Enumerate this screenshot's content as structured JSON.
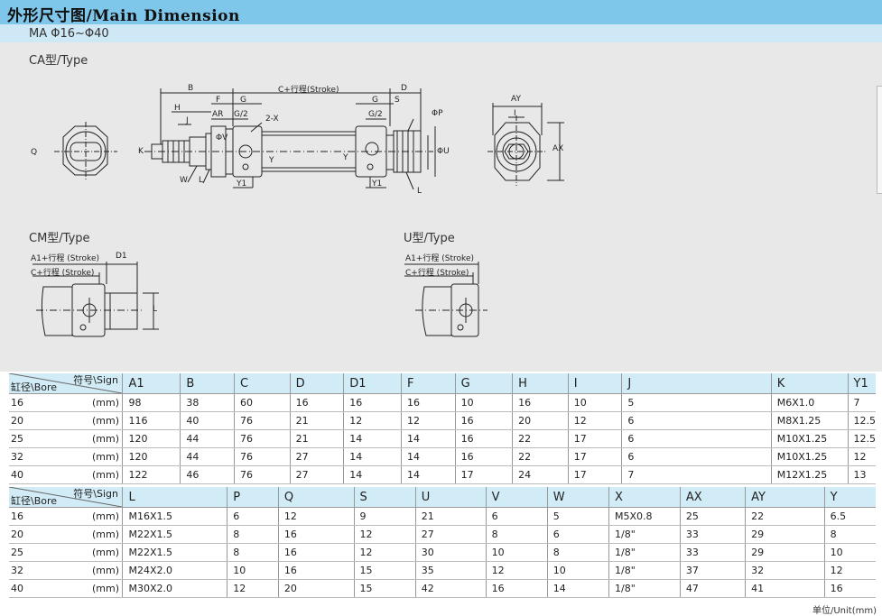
{
  "header": {
    "title": "外形尺寸图/Main Dimension",
    "model": "MA Φ16~Φ40"
  },
  "drawings": {
    "ca_label": "CA型/Type",
    "cm_label": "CM型/Type",
    "u_label": "U型/Type",
    "ca_dims": {
      "b": "B",
      "h": "H",
      "j": "J",
      "k": "K",
      "w": "W",
      "l": "L",
      "f": "F",
      "ar": "AR",
      "g": "G",
      "g2": "G/2",
      "twox": "2-X",
      "y1": "Y1",
      "y": "Y",
      "v": "ΦV",
      "stroke": "C+行程(Stroke)",
      "d": "D",
      "s": "S",
      "p": "ΦP",
      "u": "ΦU",
      "ay": "AY",
      "i": "I",
      "ax": "AX",
      "q": "Q"
    },
    "cm_dims": {
      "a1": "A1+行程 (Stroke)",
      "d1": "D1",
      "c": "C+行程 (Stroke)",
      "l": "L"
    },
    "u_dims": {
      "a1": "A1+行程 (Stroke)",
      "c": "C+行程 (Stroke)"
    }
  },
  "table1": {
    "corner_sign": "符号\\Sign",
    "corner_bore": "缸径\\Bore",
    "columns": [
      "A1",
      "B",
      "C",
      "D",
      "D1",
      "F",
      "G",
      "H",
      "I",
      "J",
      "K",
      "Y1"
    ],
    "rows": [
      {
        "bore": "16",
        "unit": "(mm)",
        "cells": [
          "98",
          "38",
          "60",
          "16",
          "16",
          "16",
          "10",
          "16",
          "10",
          "5",
          "M6X1.0",
          "7"
        ]
      },
      {
        "bore": "20",
        "unit": "(mm)",
        "cells": [
          "116",
          "40",
          "76",
          "21",
          "12",
          "12",
          "16",
          "20",
          "12",
          "6",
          "M8X1.25",
          "12.5"
        ]
      },
      {
        "bore": "25",
        "unit": "(mm)",
        "cells": [
          "120",
          "44",
          "76",
          "21",
          "14",
          "14",
          "16",
          "22",
          "17",
          "6",
          "M10X1.25",
          "12.5"
        ]
      },
      {
        "bore": "32",
        "unit": "(mm)",
        "cells": [
          "120",
          "44",
          "76",
          "27",
          "14",
          "14",
          "16",
          "22",
          "17",
          "6",
          "M10X1.25",
          "12"
        ]
      },
      {
        "bore": "40",
        "unit": "(mm)",
        "cells": [
          "122",
          "46",
          "76",
          "27",
          "14",
          "14",
          "17",
          "24",
          "17",
          "7",
          "M12X1.25",
          "13"
        ]
      }
    ]
  },
  "table2": {
    "corner_sign": "符号\\Sign",
    "corner_bore": "缸径\\Bore",
    "columns": [
      "L",
      "P",
      "Q",
      "S",
      "U",
      "V",
      "W",
      "X",
      "AX",
      "AY",
      "Y"
    ],
    "rows": [
      {
        "bore": "16",
        "unit": "(mm)",
        "cells": [
          "M16X1.5",
          "6",
          "12",
          "9",
          "21",
          "6",
          "5",
          "M5X0.8",
          "25",
          "22",
          "6.5"
        ]
      },
      {
        "bore": "20",
        "unit": "(mm)",
        "cells": [
          "M22X1.5",
          "8",
          "16",
          "12",
          "27",
          "8",
          "6",
          "1/8\"",
          "33",
          "29",
          "8"
        ]
      },
      {
        "bore": "25",
        "unit": "(mm)",
        "cells": [
          "M22X1.5",
          "8",
          "16",
          "12",
          "30",
          "10",
          "8",
          "1/8\"",
          "33",
          "29",
          "10"
        ]
      },
      {
        "bore": "32",
        "unit": "(mm)",
        "cells": [
          "M24X2.0",
          "10",
          "16",
          "15",
          "35",
          "12",
          "10",
          "1/8\"",
          "37",
          "32",
          "12"
        ]
      },
      {
        "bore": "40",
        "unit": "(mm)",
        "cells": [
          "M30X2.0",
          "12",
          "20",
          "15",
          "42",
          "16",
          "14",
          "1/8\"",
          "47",
          "41",
          "16"
        ]
      }
    ]
  },
  "footer": {
    "unit": "单位/Unit(mm)"
  }
}
